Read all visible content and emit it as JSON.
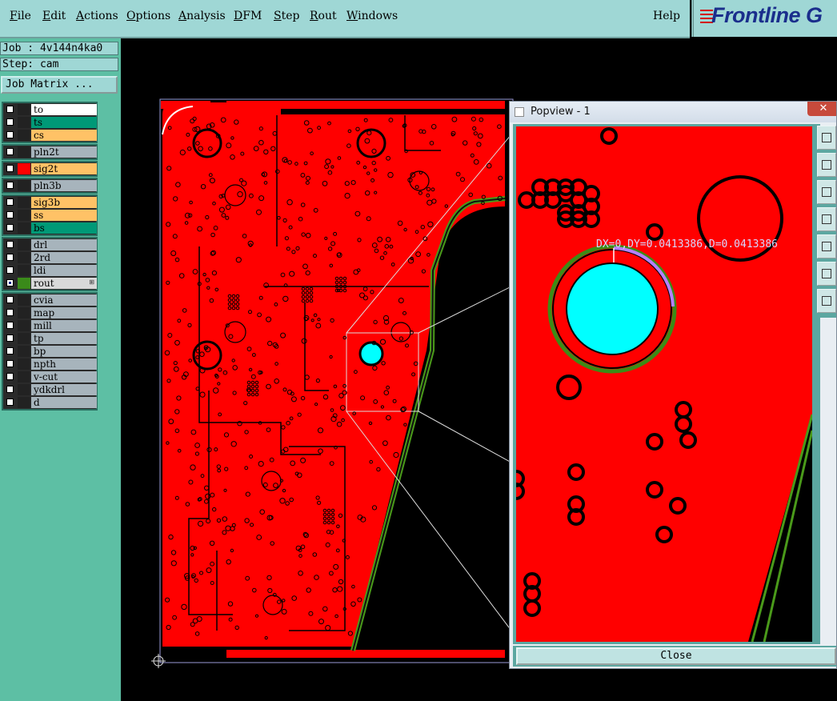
{
  "menu": {
    "items": [
      {
        "pre": "",
        "u": "F",
        "post": "ile"
      },
      {
        "pre": "",
        "u": "E",
        "post": "dit"
      },
      {
        "pre": "",
        "u": "A",
        "post": "ctions"
      },
      {
        "pre": "",
        "u": "O",
        "post": "ptions"
      },
      {
        "pre": "",
        "u": "A",
        "post": "nalysis"
      },
      {
        "pre": "",
        "u": "D",
        "post": "FM"
      },
      {
        "pre": "",
        "u": "S",
        "post": "tep"
      },
      {
        "pre": "",
        "u": "R",
        "post": "out"
      },
      {
        "pre": "",
        "u": "W",
        "post": "indows"
      }
    ],
    "help": "Help"
  },
  "logo": {
    "brand": "Frontline",
    "extra": "G"
  },
  "job": {
    "job_line": "Job : 4v144n4ka0",
    "step_line": "Step: cam",
    "matrix_button": "Job Matrix ..."
  },
  "colors": {
    "red": "#ff0000",
    "teal": "#009977",
    "orange": "#ffc266",
    "gray": "#a7b4bc",
    "white": "#ffffff",
    "cyan": "#00ffff",
    "green": "#4a9a1a"
  },
  "layers": [
    {
      "group": [
        {
          "name": "to",
          "color": "#ffffff",
          "sw": "#222222"
        },
        {
          "name": "ts",
          "color": "#009977",
          "sw": "#222222"
        },
        {
          "name": "cs",
          "color": "#ffc266",
          "sw": "#222222"
        }
      ]
    },
    {
      "group": [
        {
          "name": "pln2t",
          "color": "#a7b4bc",
          "sw": "#222222"
        }
      ]
    },
    {
      "group": [
        {
          "name": "sig2t",
          "color": "#ffc266",
          "sw": "#ff0000"
        }
      ]
    },
    {
      "group": [
        {
          "name": "pln3b",
          "color": "#a7b4bc",
          "sw": "#222222"
        }
      ]
    },
    {
      "group": [
        {
          "name": "sig3b",
          "color": "#ffc266",
          "sw": "#222222"
        },
        {
          "name": "ss",
          "color": "#ffc266",
          "sw": "#222222"
        },
        {
          "name": "bs",
          "color": "#009977",
          "sw": "#222222"
        }
      ]
    },
    {
      "group": [
        {
          "name": "drl",
          "color": "#a7b4bc",
          "sw": "#222222"
        },
        {
          "name": "2rd",
          "color": "#a7b4bc",
          "sw": "#222222"
        },
        {
          "name": "ldi",
          "color": "#a7b4bc",
          "sw": "#222222"
        },
        {
          "name": "rout",
          "color": "#d9d9d9",
          "sw": "#3a8a1a",
          "selected": true
        }
      ]
    },
    {
      "group": [
        {
          "name": "cvia",
          "color": "#a7b4bc",
          "sw": "#222222"
        },
        {
          "name": "map",
          "color": "#a7b4bc",
          "sw": "#222222"
        },
        {
          "name": "mill",
          "color": "#a7b4bc",
          "sw": "#222222"
        },
        {
          "name": "tp",
          "color": "#a7b4bc",
          "sw": "#222222"
        },
        {
          "name": "bp",
          "color": "#a7b4bc",
          "sw": "#222222"
        },
        {
          "name": "npth",
          "color": "#a7b4bc",
          "sw": "#222222"
        },
        {
          "name": "v-cut",
          "color": "#a7b4bc",
          "sw": "#222222"
        },
        {
          "name": "ydkdrl",
          "color": "#a7b4bc",
          "sw": "#222222"
        },
        {
          "name": "d",
          "color": "#a7b4bc",
          "sw": "#222222"
        }
      ]
    }
  ],
  "popview": {
    "title": "Popview - 1",
    "close_x": "✕",
    "measurement": "DX=0,DY=0.0413386,D=0.0413386",
    "close_button": "Close",
    "tools": [
      "zoom-icon",
      "pan-up-icon",
      "pan-down-icon",
      "pan-left-icon",
      "pan-right-icon",
      "zoom-in-icon",
      "zoom-out-icon"
    ]
  }
}
